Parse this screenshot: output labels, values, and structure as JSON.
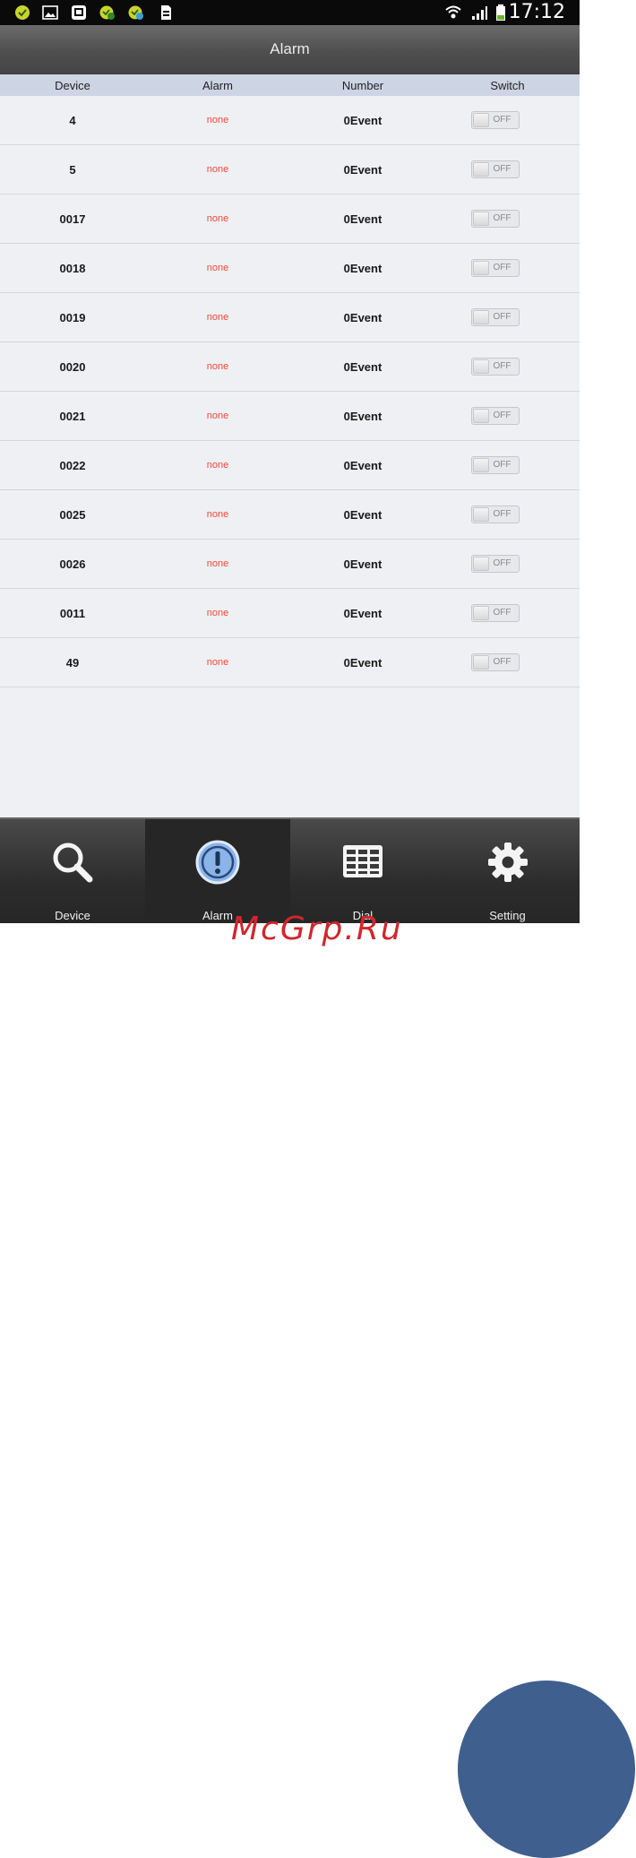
{
  "status_bar": {
    "time": "17:12"
  },
  "title": "Alarm",
  "columns": [
    "Device",
    "Alarm",
    "Number",
    "Switch"
  ],
  "rows": [
    {
      "device": "4",
      "alarm": "none",
      "number": "0Event",
      "switch": "OFF"
    },
    {
      "device": "5",
      "alarm": "none",
      "number": "0Event",
      "switch": "OFF"
    },
    {
      "device": "0017",
      "alarm": "none",
      "number": "0Event",
      "switch": "OFF"
    },
    {
      "device": "0018",
      "alarm": "none",
      "number": "0Event",
      "switch": "OFF"
    },
    {
      "device": "0019",
      "alarm": "none",
      "number": "0Event",
      "switch": "OFF"
    },
    {
      "device": "0020",
      "alarm": "none",
      "number": "0Event",
      "switch": "OFF"
    },
    {
      "device": "0021",
      "alarm": "none",
      "number": "0Event",
      "switch": "OFF"
    },
    {
      "device": "0022",
      "alarm": "none",
      "number": "0Event",
      "switch": "OFF"
    },
    {
      "device": "0025",
      "alarm": "none",
      "number": "0Event",
      "switch": "OFF"
    },
    {
      "device": "0026",
      "alarm": "none",
      "number": "0Event",
      "switch": "OFF"
    },
    {
      "device": "0011",
      "alarm": "none",
      "number": "0Event",
      "switch": "OFF"
    },
    {
      "device": "49",
      "alarm": "none",
      "number": "0Event",
      "switch": "OFF"
    }
  ],
  "nav": [
    {
      "label": "Device",
      "icon": "search-icon",
      "active": false
    },
    {
      "label": "Alarm",
      "icon": "alert-icon",
      "active": true
    },
    {
      "label": "Dial",
      "icon": "dialpad-icon",
      "active": false
    },
    {
      "label": "Setting",
      "icon": "gear-icon",
      "active": false
    }
  ],
  "watermark": "McGrp.Ru",
  "colors": {
    "alarm_text": "#f04a3a",
    "header_bg": "#cdd4e4",
    "active_icon": "#8ab4ea",
    "circle": "#3f5f8f"
  }
}
